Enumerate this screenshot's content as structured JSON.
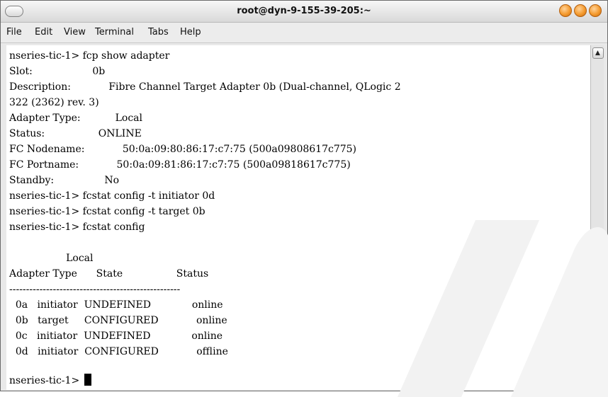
{
  "window": {
    "title": "root@dyn-9-155-39-205:~"
  },
  "menubar": {
    "items": [
      "File",
      "Edit",
      "View",
      "Terminal",
      "Tabs",
      "Help"
    ]
  },
  "terminal": {
    "lines": [
      "nseries-tic-1> fcp show adapter",
      "Slot:                   0b",
      "Description:            Fibre Channel Target Adapter 0b (Dual-channel, QLogic 2",
      "322 (2362) rev. 3)",
      "Adapter Type:           Local",
      "Status:                 ONLINE",
      "FC Nodename:            50:0a:09:80:86:17:c7:75 (500a09808617c775)",
      "FC Portname:            50:0a:09:81:86:17:c7:75 (500a09818617c775)",
      "Standby:                No",
      "nseries-tic-1> fcstat config -t initiator 0d",
      "nseries-tic-1> fcstat config -t target 0b",
      "nseries-tic-1> fcstat config",
      "",
      "                  Local",
      "Adapter Type      State                 Status",
      "---------------------------------------------------",
      "  0a   initiator  UNDEFINED             online",
      "  0b   target     CONFIGURED            online",
      "  0c   initiator  UNDEFINED             online",
      "  0d   initiator  CONFIGURED            offline",
      "",
      "nseries-tic-1> "
    ]
  },
  "icons": {
    "window_menu": "window-menu-icon",
    "minimize": "minimize-icon",
    "maximize": "maximize-icon",
    "close": "close-icon",
    "scroll_up": "scroll-up-arrow-icon",
    "scroll_down": "scroll-down-arrow-icon"
  },
  "colors": {
    "titlebar": "#e0e0e0",
    "window_buttons": "#f49a2e",
    "scroll_thumb": "#5c8ac9",
    "terminal_bg": "#ffffff",
    "terminal_fg": "#000000"
  }
}
